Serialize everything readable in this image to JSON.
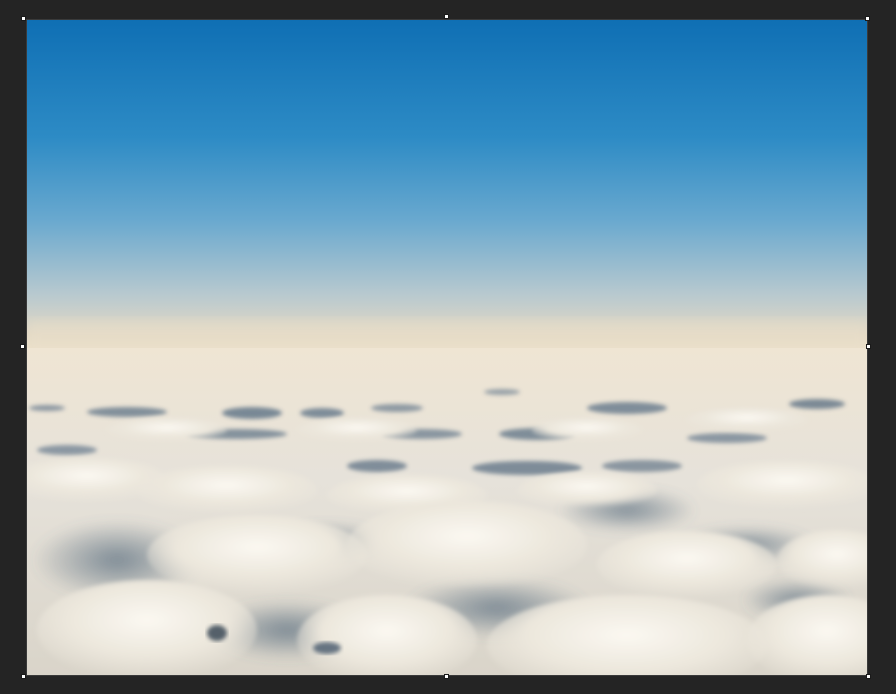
{
  "app": {
    "canvas_background": "#242424"
  },
  "image": {
    "subject": "sea-of-clouds-photo",
    "sky_top_color": "#0f6fb4",
    "sky_mid_color": "#5aa0cc",
    "horizon_color": "#e8dcc4",
    "cloud_color": "#f2ede3",
    "cloud_shadow_color": "#5e6f80"
  },
  "transform": {
    "handle_icons": [
      "handle-top-left-icon",
      "handle-top-center-icon",
      "handle-top-right-icon",
      "handle-middle-left-icon",
      "handle-middle-right-icon",
      "handle-bottom-left-icon",
      "handle-bottom-center-icon",
      "handle-bottom-right-icon"
    ]
  }
}
